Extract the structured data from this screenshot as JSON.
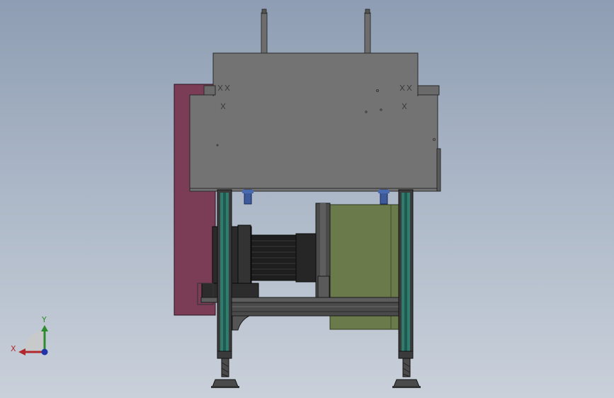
{
  "viewport": {
    "background_top": "#8e9db3",
    "background_bottom": "#c9d0da"
  },
  "model": {
    "colors": {
      "housing": "#737373",
      "housing_edge": "#2a2a2a",
      "side_panel": "#7a3d55",
      "frame_profile": "#2f7d6e",
      "frame_dark": "#3b3b3b",
      "motor": "#1e1e1e",
      "guard_panel": "#6b7a4a",
      "bracket": "#3c5a9c",
      "foot": "#4a4a4a"
    }
  },
  "triad": {
    "x_label": "X",
    "y_label": "Y",
    "x_color": "#b0282c",
    "y_color": "#2e8b2e",
    "z_color": "#2233aa"
  }
}
